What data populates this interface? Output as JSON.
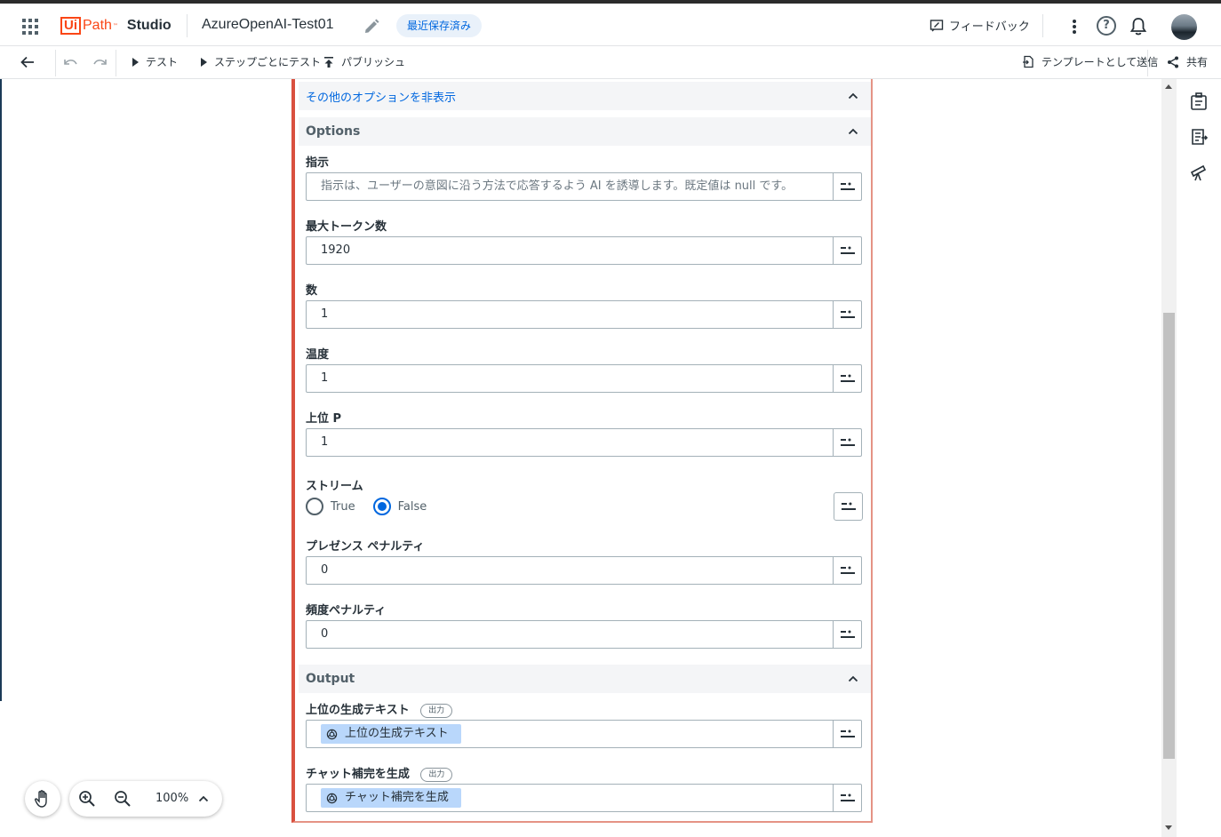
{
  "header": {
    "logo_ui": "Ui",
    "logo_path": "Path",
    "logo_tm": "™",
    "product": "Studio",
    "project_title": "AzureOpenAI-Test01",
    "save_status": "最近保存済み",
    "feedback_label": "フィードバック",
    "help_glyph": "?"
  },
  "toolbar": {
    "test_label": "テスト",
    "step_test_label": "ステップごとにテスト",
    "publish_label": "パブリッシュ",
    "template_label": "テンプレートとして送信",
    "share_label": "共有"
  },
  "card": {
    "hide_options_link": "その他のオプションを非表示",
    "options_section": "Options",
    "output_section": "Output",
    "fields": [
      {
        "label": "指示",
        "value": "",
        "placeholder": "指示は、ユーザーの意図に沿う方法で応答するよう AI を誘導します。既定値は null です。"
      },
      {
        "label": "最大トークン数",
        "value": "1920"
      },
      {
        "label": "数",
        "value": "1"
      },
      {
        "label": "温度",
        "value": "1"
      },
      {
        "label": "上位 P",
        "value": "1"
      },
      {
        "label": "プレゼンス ペナルティ",
        "value": "0"
      },
      {
        "label": "頻度ペナルティ",
        "value": "0"
      }
    ],
    "stream": {
      "label": "ストリーム",
      "true_label": "True",
      "false_label": "False",
      "selected": "False"
    },
    "outputs": [
      {
        "label": "上位の生成テキスト",
        "badge": "出力",
        "chip": "上位の生成テキスト"
      },
      {
        "label": "チャット補完を生成",
        "badge": "出力",
        "chip": "チャット補完を生成"
      }
    ]
  },
  "zoom": {
    "level": "100%"
  },
  "colors": {
    "accent": "#0067df",
    "brand": "#fa4616",
    "card_border": "#d9503f",
    "chip_bg": "#b9d7fb"
  }
}
